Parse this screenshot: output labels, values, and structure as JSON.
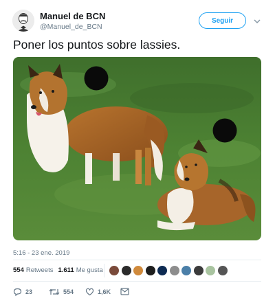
{
  "author": {
    "name": "Manuel de BCN",
    "handle": "@Manuel_de_BCN"
  },
  "follow_button": {
    "label": "Seguir"
  },
  "tweet": {
    "text": "Poner los puntos sobre lassies.",
    "timestamp": "5:16 - 23 ene. 2019"
  },
  "stats": {
    "retweets_count": "554",
    "retweets_label": "Retweets",
    "likes_count": "1.611",
    "likes_label": "Me gusta"
  },
  "likers_colors": [
    "#7a4a3a",
    "#2b2b2b",
    "#d08a3c",
    "#1e1e1e",
    "#0d2a52",
    "#8d8d8d",
    "#4b7fa8",
    "#3b3b3b",
    "#a9c4a0",
    "#555555"
  ],
  "actions": {
    "reply_count": "23",
    "retweet_count": "554",
    "like_count": "1,6K"
  },
  "colors": {
    "accent": "#1da1f2",
    "secondary_text": "#657786",
    "primary_text": "#14171a"
  }
}
